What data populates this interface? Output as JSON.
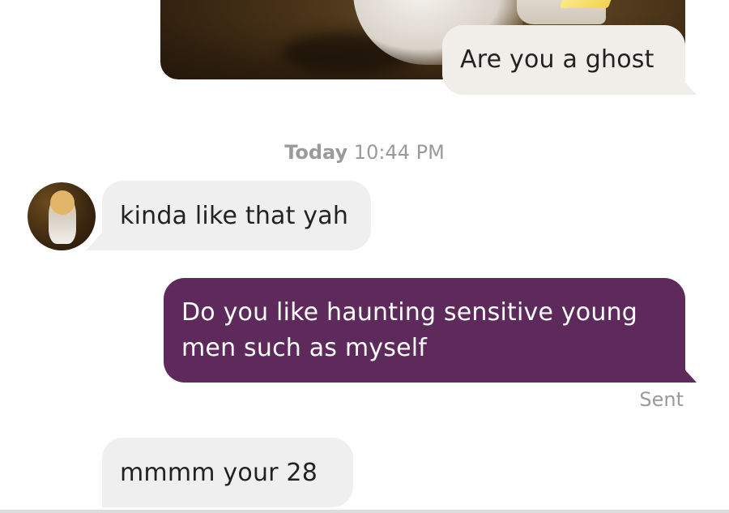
{
  "conversation": {
    "messages": [
      {
        "type": "photo",
        "direction": "sent",
        "caption": "Are you a ghost"
      },
      {
        "type": "timestamp",
        "day": "Today",
        "time": "10:44 PM"
      },
      {
        "type": "text",
        "direction": "received",
        "text": "kinda like that yah"
      },
      {
        "type": "text",
        "direction": "sent",
        "text": "Do you like haunting sensitive young men such as myself",
        "status": "Sent"
      },
      {
        "type": "text",
        "direction": "received",
        "text": "mmmm your 28"
      }
    ]
  },
  "colors": {
    "sent_bubble": "#5e2a5c",
    "received_bubble": "#efefef",
    "sent_light_bubble": "#f1eeea",
    "meta_text": "#9a9a9a"
  }
}
